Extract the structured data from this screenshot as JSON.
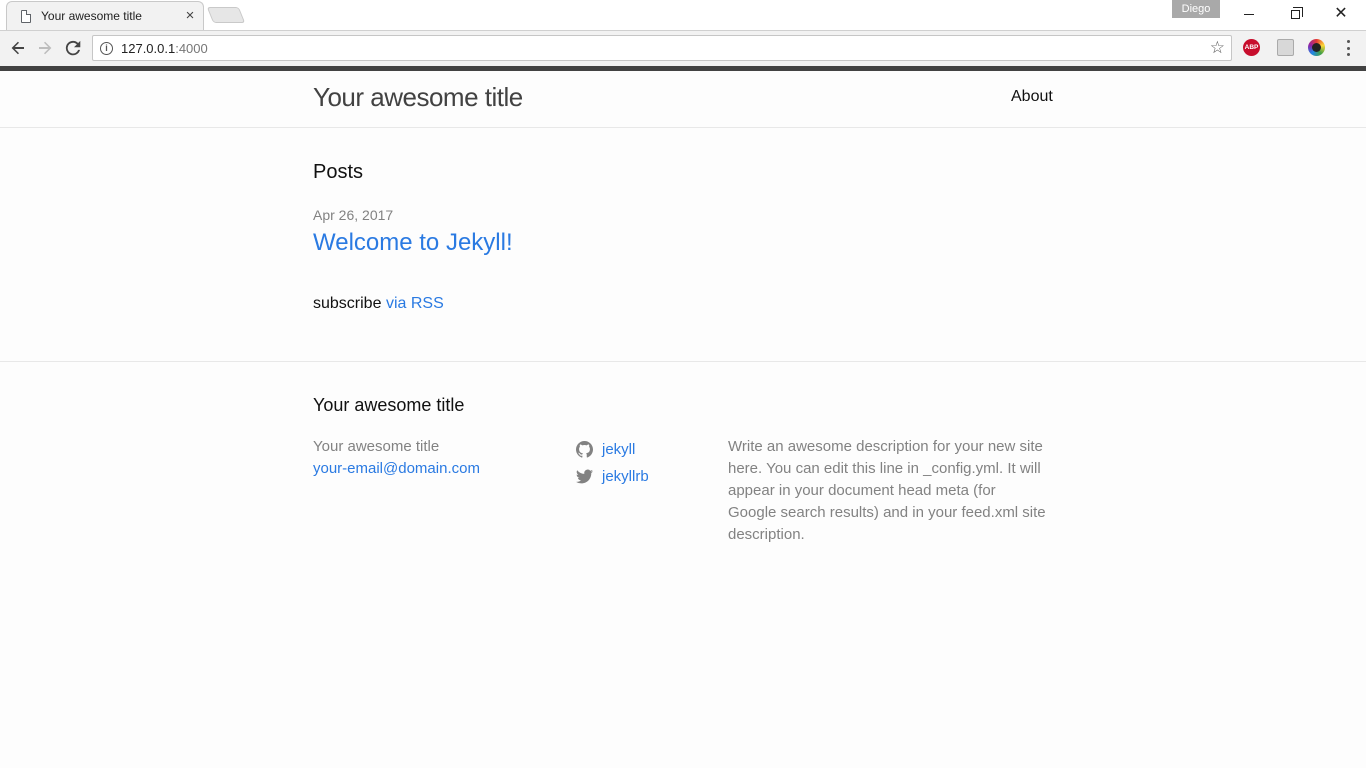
{
  "browser": {
    "tab_title": "Your awesome title",
    "profile_name": "Diego",
    "url_host": "127.0.0.1",
    "url_port": ":4000",
    "extensions": {
      "adblock_label": "ABP"
    }
  },
  "site": {
    "title": "Your awesome title",
    "nav": {
      "about": "About"
    }
  },
  "posts": {
    "heading": "Posts",
    "items": [
      {
        "date": "Apr 26, 2017",
        "title": "Welcome to Jekyll!"
      }
    ],
    "subscribe_prefix": "subscribe",
    "subscribe_link": "via RSS"
  },
  "footer": {
    "heading": "Your awesome title",
    "name": "Your awesome title",
    "email": "your-email@domain.com",
    "github_user": "jekyll",
    "twitter_user": "jekyllrb",
    "description": "Write an awesome description for your new site here. You can edit this line in _config.yml. It will appear in your document head meta (for Google search results) and in your feed.xml site description."
  },
  "colors": {
    "link": "#2a7ae2",
    "text": "#111111",
    "muted": "#828282",
    "header_bar": "#424242"
  }
}
